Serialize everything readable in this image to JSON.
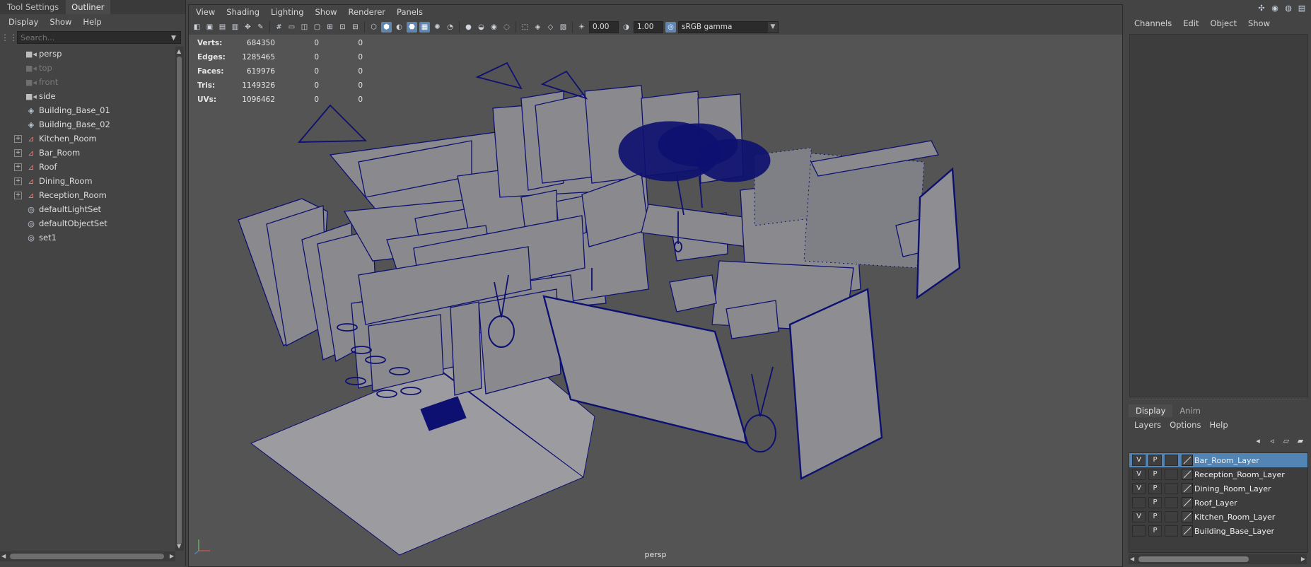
{
  "outliner": {
    "tabs": [
      {
        "label": "Tool Settings",
        "active": false
      },
      {
        "label": "Outliner",
        "active": true
      }
    ],
    "menu": [
      "Display",
      "Show",
      "Help"
    ],
    "search_placeholder": "Search...",
    "items": [
      {
        "label": "persp",
        "icon": "camera-icon",
        "dim": false,
        "expandable": false
      },
      {
        "label": "top",
        "icon": "camera-icon",
        "dim": true,
        "expandable": false
      },
      {
        "label": "front",
        "icon": "camera-icon",
        "dim": true,
        "expandable": false
      },
      {
        "label": "side",
        "icon": "camera-icon",
        "dim": false,
        "expandable": false
      },
      {
        "label": "Building_Base_01",
        "icon": "mesh-icon",
        "dim": false,
        "expandable": false
      },
      {
        "label": "Building_Base_02",
        "icon": "mesh-icon",
        "dim": false,
        "expandable": false
      },
      {
        "label": "Kitchen_Room",
        "icon": "group-icon",
        "dim": false,
        "expandable": true
      },
      {
        "label": "Bar_Room",
        "icon": "group-icon",
        "dim": false,
        "expandable": true
      },
      {
        "label": "Roof",
        "icon": "group-icon",
        "dim": false,
        "expandable": true
      },
      {
        "label": "Dining_Room",
        "icon": "group-icon",
        "dim": false,
        "expandable": true
      },
      {
        "label": "Reception_Room",
        "icon": "group-icon",
        "dim": false,
        "expandable": true
      },
      {
        "label": "defaultLightSet",
        "icon": "set-icon",
        "dim": false,
        "expandable": false
      },
      {
        "label": "defaultObjectSet",
        "icon": "set-icon",
        "dim": false,
        "expandable": false
      },
      {
        "label": "set1",
        "icon": "set-icon",
        "dim": false,
        "expandable": false
      }
    ]
  },
  "viewport": {
    "menu": [
      "View",
      "Shading",
      "Lighting",
      "Show",
      "Renderer",
      "Panels"
    ],
    "exposure": "0.00",
    "gamma": "1.00",
    "color_space": "sRGB gamma",
    "hud": [
      {
        "label": "Verts:",
        "value": "684350",
        "a": "0",
        "b": "0"
      },
      {
        "label": "Edges:",
        "value": "1285465",
        "a": "0",
        "b": "0"
      },
      {
        "label": "Faces:",
        "value": "619976",
        "a": "0",
        "b": "0"
      },
      {
        "label": "Tris:",
        "value": "1149326",
        "a": "0",
        "b": "0"
      },
      {
        "label": "UVs:",
        "value": "1096462",
        "a": "0",
        "b": "0"
      }
    ],
    "camera_label": "persp",
    "wire_color": "#0d1070",
    "surface_color": "#8a8a8e",
    "floor_color": "#9c9ca0"
  },
  "channel_box": {
    "menu": [
      "Channels",
      "Edit",
      "Object",
      "Show"
    ]
  },
  "layers": {
    "tabs": [
      {
        "label": "Display",
        "active": true
      },
      {
        "label": "Anim",
        "active": false
      }
    ],
    "menu": [
      "Layers",
      "Options",
      "Help"
    ],
    "rows": [
      {
        "name": "Bar_Room_Layer",
        "v": "V",
        "p": "P",
        "selected": true
      },
      {
        "name": "Reception_Room_Layer",
        "v": "V",
        "p": "P",
        "selected": false
      },
      {
        "name": "Dining_Room_Layer",
        "v": "V",
        "p": "P",
        "selected": false
      },
      {
        "name": "Roof_Layer",
        "v": "",
        "p": "P",
        "selected": false
      },
      {
        "name": "Kitchen_Room_Layer",
        "v": "V",
        "p": "P",
        "selected": false
      },
      {
        "name": "Building_Base_Layer",
        "v": "",
        "p": "P",
        "selected": false
      }
    ]
  }
}
